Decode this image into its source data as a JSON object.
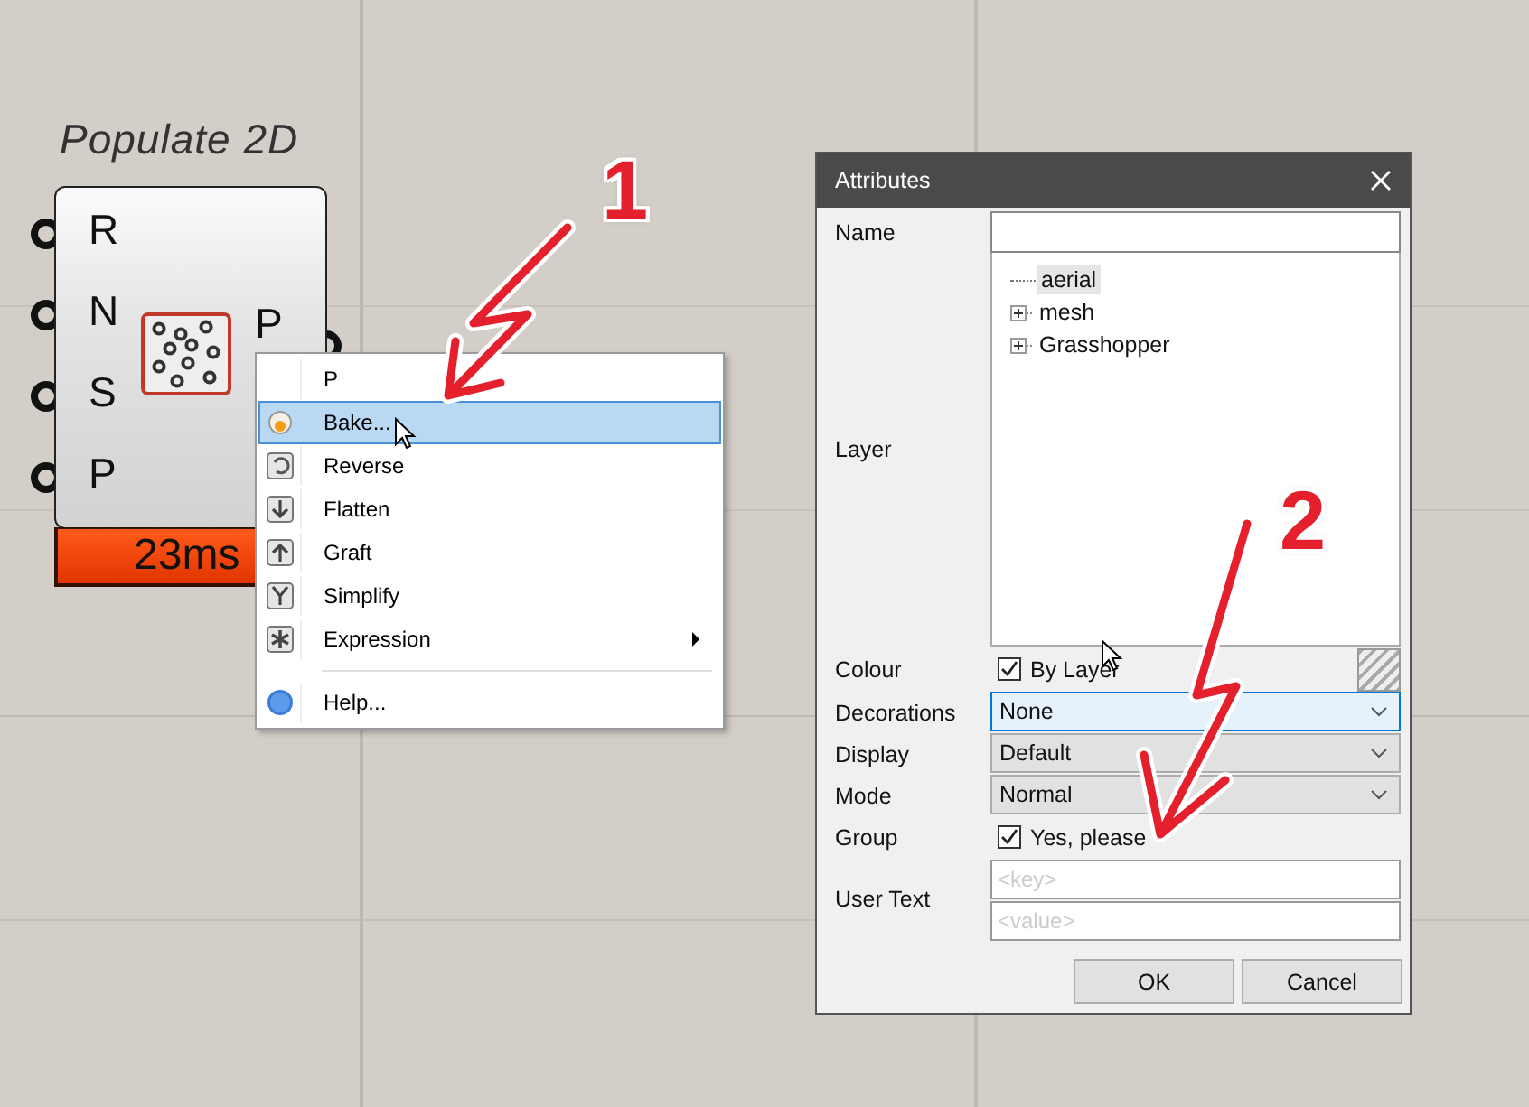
{
  "component": {
    "title": "Populate 2D",
    "inputs": [
      "R",
      "N",
      "S",
      "P"
    ],
    "output": "P",
    "timing": "23ms"
  },
  "context_menu": {
    "items": [
      {
        "kind": "header",
        "label": "P"
      },
      {
        "kind": "item",
        "label": "Bake...",
        "selected": true
      },
      {
        "kind": "item",
        "label": "Reverse",
        "selected": false
      },
      {
        "kind": "item",
        "label": "Flatten",
        "selected": false
      },
      {
        "kind": "item",
        "label": "Graft",
        "selected": false
      },
      {
        "kind": "item",
        "label": "Simplify",
        "selected": false
      },
      {
        "kind": "submenu",
        "label": "Expression",
        "selected": false
      },
      {
        "kind": "separator"
      },
      {
        "kind": "item",
        "label": "Help...",
        "selected": false
      }
    ]
  },
  "dialog": {
    "title": "Attributes",
    "name": {
      "label": "Name"
    },
    "layer": {
      "label": "Layer",
      "tree": [
        {
          "kind": "leaf",
          "label": "aerial",
          "selected": true
        },
        {
          "kind": "group",
          "label": "mesh",
          "selected": false
        },
        {
          "kind": "group",
          "label": "Grasshopper",
          "selected": false
        }
      ]
    },
    "colour": {
      "label": "Colour",
      "checkbox": {
        "label": "By Layer",
        "checked": true
      }
    },
    "combos": [
      {
        "label": "Decorations",
        "value": "None",
        "focused": true
      },
      {
        "label": "Display",
        "value": "Default",
        "focused": false
      },
      {
        "label": "Mode",
        "value": "Normal",
        "focused": false
      }
    ],
    "group": {
      "label": "Group",
      "checkbox": {
        "label": "Yes, please",
        "checked": true
      }
    },
    "user_text": {
      "label": "User Text",
      "key_placeholder": "<key>",
      "value_placeholder": "<value>"
    },
    "buttons": [
      "OK",
      "Cancel"
    ]
  },
  "annotations": [
    {
      "label": "1"
    },
    {
      "label": "2"
    }
  ]
}
